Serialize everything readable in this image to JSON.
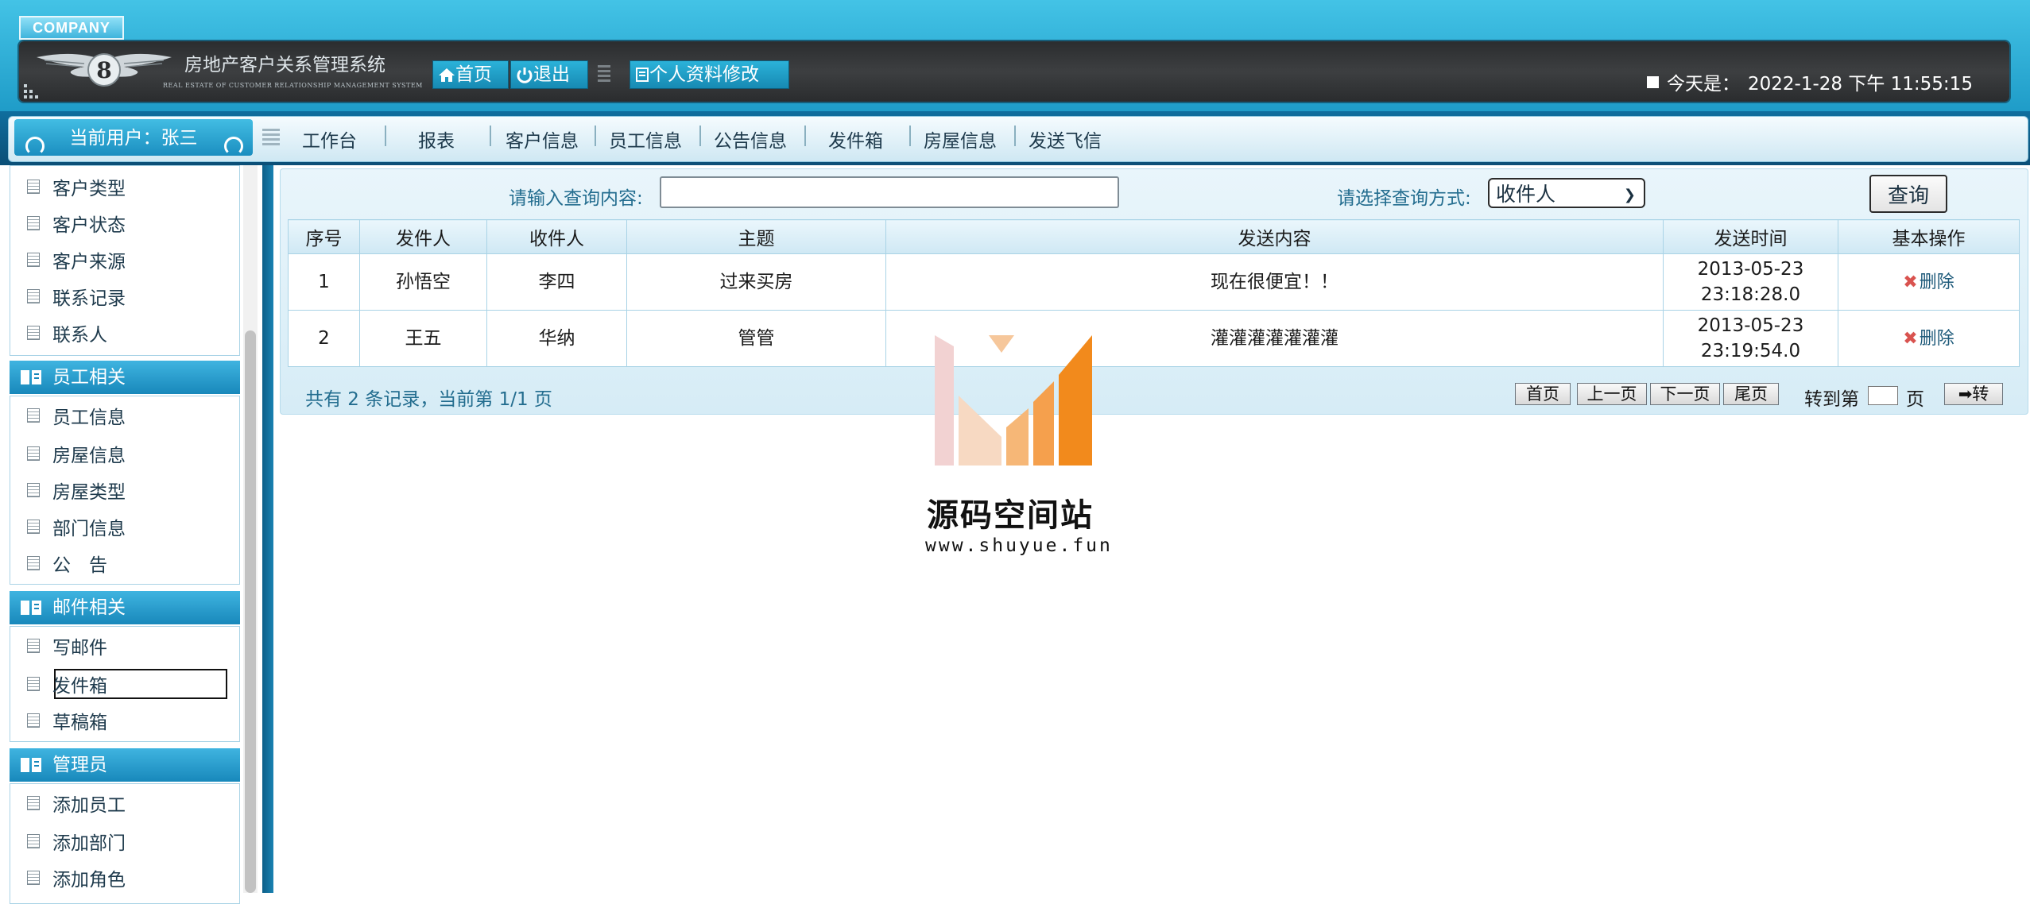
{
  "header": {
    "company_tag": "COMPANY",
    "system_title": "房地产客户关系管理系统",
    "system_subtitle": "REAL ESTATE OF CUSTOMER RELATIONSHIP MANAGEMENT SYSTEM",
    "home_label": "首页",
    "exit_label": "退出",
    "profile_label": "个人资料修改",
    "date_prefix": "今天是：",
    "date_value": "2022-1-28 下午 11:55:15"
  },
  "nav": {
    "current_user": "当前用户：张三",
    "items": [
      "工作台",
      "报表",
      "客户信息",
      "员工信息",
      "公告信息",
      "发件箱",
      "房屋信息",
      "发送飞信"
    ]
  },
  "sidebar": {
    "group_customer_items": [
      "客户类型",
      "客户状态",
      "客户来源",
      "联系记录",
      "联系人"
    ],
    "group_staff": {
      "title": "员工相关",
      "items": [
        "员工信息",
        "房屋信息",
        "房屋类型",
        "部门信息",
        "公　告"
      ]
    },
    "group_mail": {
      "title": "邮件相关",
      "items": [
        "写邮件",
        "发件箱",
        "草稿箱"
      ]
    },
    "group_admin": {
      "title": "管理员",
      "items": [
        "添加员工",
        "添加部门",
        "添加角色"
      ]
    }
  },
  "search": {
    "query_label": "请输入查询内容:",
    "query_value": "",
    "mode_label": "请选择查询方式:",
    "mode_selected": "收件人",
    "submit_label": "查询"
  },
  "table": {
    "columns": [
      "序号",
      "发件人",
      "收件人",
      "主题",
      "发送内容",
      "发送时间",
      "基本操作"
    ],
    "rows": [
      {
        "no": "1",
        "sender": "孙悟空",
        "receiver": "李四",
        "subject": "过来买房",
        "content": "现在很便宜！！",
        "time_date": "2013-05-23",
        "time_clock": "23:18:28.0",
        "action": "删除"
      },
      {
        "no": "2",
        "sender": "王五",
        "receiver": "华纳",
        "subject": "管管",
        "content": "灌灌灌灌灌灌灌",
        "time_date": "2013-05-23",
        "time_clock": "23:19:54.0",
        "action": "删除"
      }
    ]
  },
  "pager": {
    "summary": "共有 2 条记录，当前第 1/1 页",
    "first": "首页",
    "prev": "上一页",
    "next": "下一页",
    "last": "尾页",
    "goto_label": "转到第",
    "page_unit": "页",
    "go": "➡转"
  },
  "watermark": {
    "name": "源码空间站",
    "url": "www.shuyue.fun"
  }
}
